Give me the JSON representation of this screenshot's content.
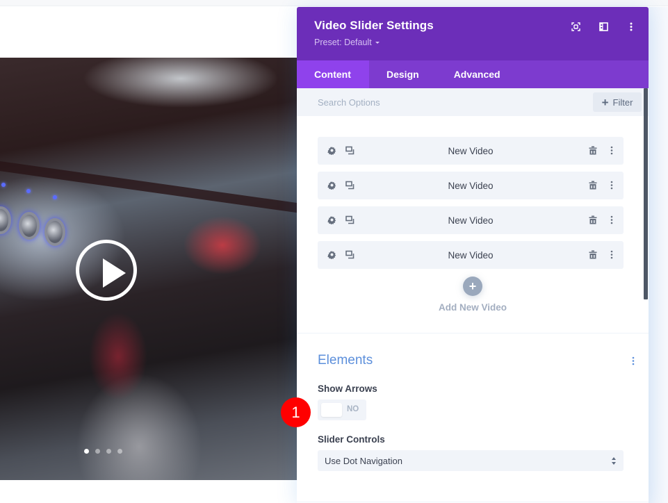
{
  "panel": {
    "title": "Video Slider Settings",
    "preset_label": "Preset: Default",
    "header_icons": [
      "focus-mode-icon",
      "split-view-icon",
      "more-options-icon"
    ],
    "tabs": [
      {
        "label": "Content",
        "active": true
      },
      {
        "label": "Design",
        "active": false
      },
      {
        "label": "Advanced",
        "active": false
      }
    ],
    "search": {
      "placeholder": "Search Options",
      "value": ""
    },
    "filter_label": "Filter",
    "videos": [
      {
        "label": "New Video"
      },
      {
        "label": "New Video"
      },
      {
        "label": "New Video"
      },
      {
        "label": "New Video"
      }
    ],
    "add_new_label": "Add New Video",
    "elements_section": {
      "title": "Elements",
      "show_arrows": {
        "label": "Show Arrows",
        "value": "NO",
        "enabled": false
      },
      "slider_controls": {
        "label": "Slider Controls",
        "selected": "Use Dot Navigation"
      }
    }
  },
  "preview": {
    "slide_count": 4,
    "active_slide": 1
  },
  "annotation": {
    "number": "1"
  },
  "colors": {
    "header_purple": "#6c2eb9",
    "tab_bar_purple": "#7d3bcf",
    "active_tab_purple": "#8f42ec",
    "section_title_blue": "#5c8fdb",
    "badge_red": "#ff0000"
  }
}
